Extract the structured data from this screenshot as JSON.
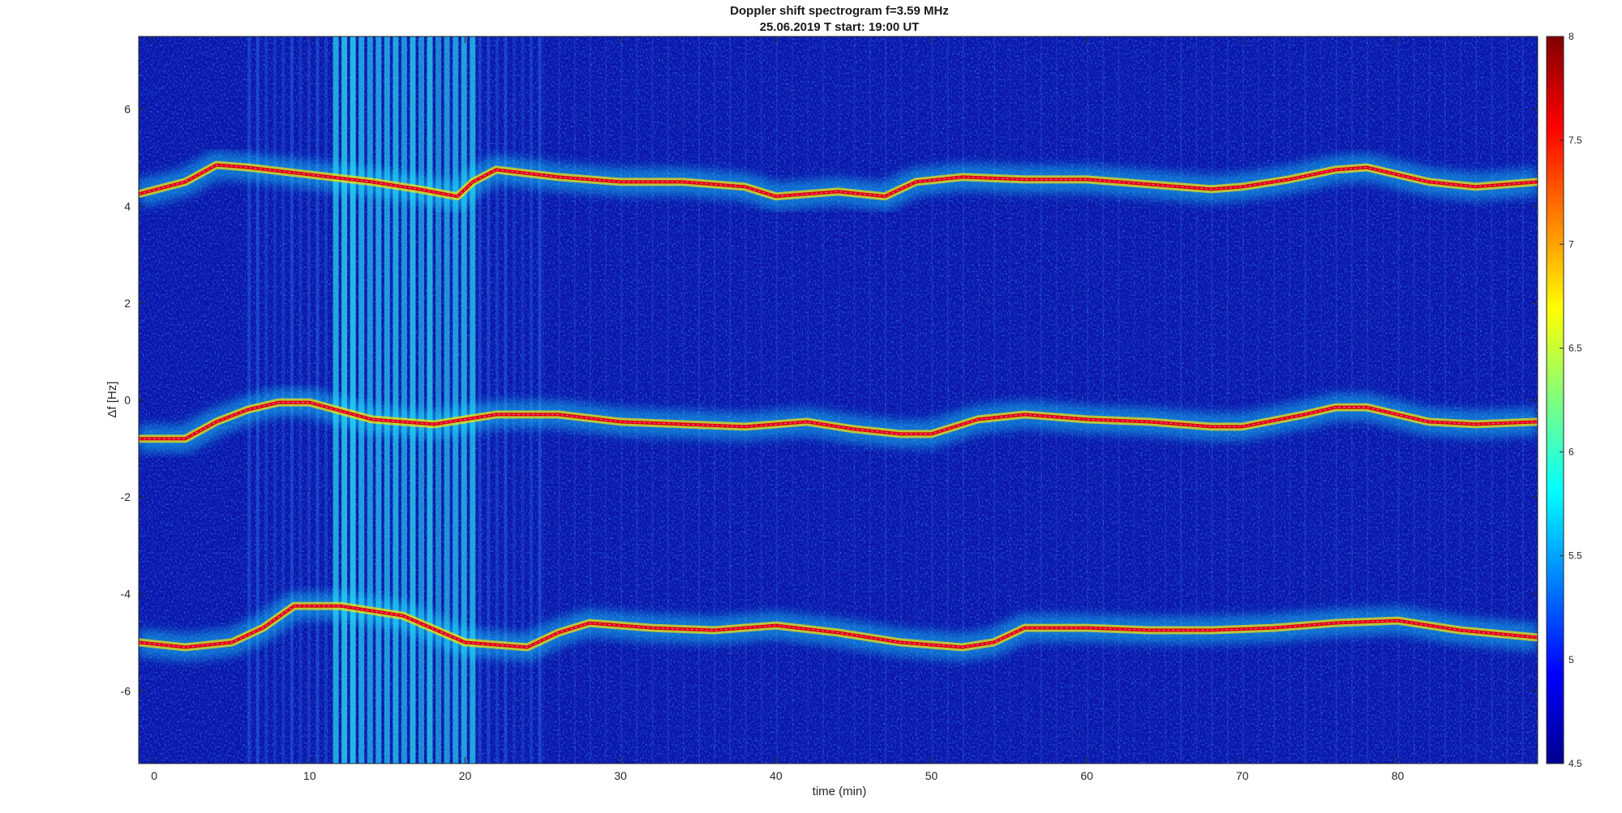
{
  "chart_data": {
    "type": "heatmap",
    "title": "Doppler shift spectrogram f=3.59 MHz",
    "subtitle": "25.06.2019   T start: 19:00 UT",
    "xlabel": "time (min)",
    "ylabel": "Δf [Hz]",
    "xlim": [
      -1,
      89
    ],
    "ylim": [
      -7.5,
      7.5
    ],
    "x_ticks": [
      0,
      10,
      20,
      30,
      40,
      50,
      60,
      70,
      80
    ],
    "y_ticks": [
      6,
      4,
      2,
      0,
      -2,
      -4,
      -6
    ],
    "colorbar": {
      "range": [
        4.5,
        8
      ],
      "ticks": [
        8,
        7.5,
        7,
        6.5,
        6,
        5.5,
        5,
        4.5
      ],
      "colormap": "jet"
    },
    "grid": false,
    "series": [
      {
        "x": [
          -1,
          2,
          4,
          6,
          10,
          14,
          17,
          19.5,
          20.5,
          22,
          26,
          30,
          34,
          38,
          40,
          44,
          47,
          49,
          52,
          56,
          60,
          64,
          68,
          70,
          73,
          76,
          78,
          82,
          85,
          89
        ],
        "y": [
          4.25,
          4.5,
          4.85,
          4.8,
          4.65,
          4.5,
          4.35,
          4.2,
          4.5,
          4.75,
          4.6,
          4.5,
          4.5,
          4.4,
          4.2,
          4.3,
          4.2,
          4.5,
          4.6,
          4.55,
          4.55,
          4.45,
          4.35,
          4.4,
          4.55,
          4.75,
          4.8,
          4.5,
          4.4,
          4.5
        ]
      },
      {
        "x": [
          -1,
          2,
          4,
          6,
          8,
          10,
          14,
          18,
          22,
          26,
          30,
          34,
          38,
          42,
          45,
          48,
          50,
          53,
          56,
          60,
          64,
          68,
          70,
          74,
          76,
          78,
          82,
          85,
          89
        ],
        "y": [
          -0.8,
          -0.8,
          -0.45,
          -0.2,
          -0.05,
          -0.05,
          -0.4,
          -0.5,
          -0.3,
          -0.3,
          -0.45,
          -0.5,
          -0.55,
          -0.45,
          -0.6,
          -0.7,
          -0.7,
          -0.4,
          -0.3,
          -0.4,
          -0.45,
          -0.55,
          -0.55,
          -0.3,
          -0.15,
          -0.15,
          -0.45,
          -0.5,
          -0.45
        ]
      },
      {
        "x": [
          -1,
          2,
          5,
          7,
          9,
          12,
          16,
          20,
          24,
          26,
          28,
          32,
          36,
          40,
          44,
          48,
          52,
          54,
          56,
          60,
          64,
          68,
          72,
          76,
          80,
          84,
          89
        ],
        "y": [
          -5.0,
          -5.1,
          -5.0,
          -4.7,
          -4.25,
          -4.25,
          -4.45,
          -5.0,
          -5.1,
          -4.8,
          -4.6,
          -4.7,
          -4.75,
          -4.65,
          -4.8,
          -5.0,
          -5.1,
          -5.0,
          -4.7,
          -4.7,
          -4.75,
          -4.75,
          -4.7,
          -4.6,
          -4.55,
          -4.75,
          -4.9
        ]
      }
    ]
  }
}
